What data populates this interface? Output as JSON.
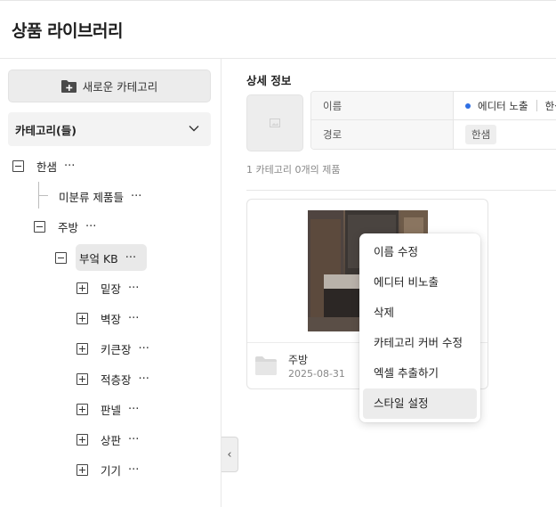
{
  "header": {
    "title": "상품 라이브러리"
  },
  "sidebar": {
    "new_category_label": "새로운 카테고리",
    "categories_header": "카테고리(들)",
    "tree": [
      {
        "label": "한샘",
        "dots": "···"
      },
      {
        "label": "미분류 제품들",
        "dots": "···"
      },
      {
        "label": "주방",
        "dots": "···"
      },
      {
        "label": "부엌 KB",
        "dots": "···"
      },
      {
        "label": "밑장",
        "dots": "···"
      },
      {
        "label": "벽장",
        "dots": "···"
      },
      {
        "label": "키큰장",
        "dots": "···"
      },
      {
        "label": "적층장",
        "dots": "···"
      },
      {
        "label": "판넬",
        "dots": "···"
      },
      {
        "label": "상판",
        "dots": "···"
      },
      {
        "label": "기기",
        "dots": "···"
      }
    ],
    "collapse_icon": "‹"
  },
  "detail": {
    "title": "상세 정보",
    "name_key": "이름",
    "name_value": "에디터 노출",
    "name_extra": "한샘",
    "path_key": "경로",
    "path_value": "한샘",
    "status_color": "#2f6fe4"
  },
  "summary": "1 카테고리 0개의 제품",
  "card": {
    "name": "주방",
    "date": "2025-08-31"
  },
  "context_menu": {
    "items": [
      "이름 수정",
      "에디터 비노출",
      "삭제",
      "카테고리 커버 수정",
      "엑셀 추출하기",
      "스타일 설정"
    ],
    "active_index": 5
  }
}
